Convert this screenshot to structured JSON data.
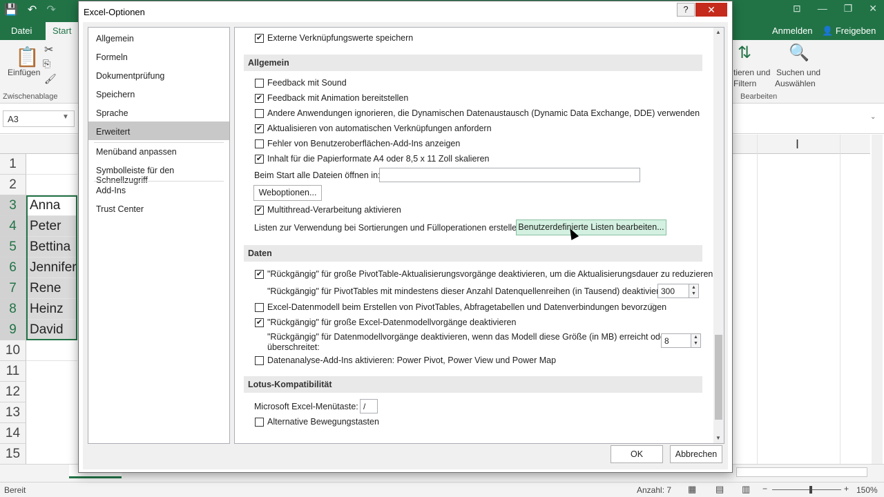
{
  "excel": {
    "tabs": {
      "datei": "Datei",
      "start": "Start"
    },
    "account": {
      "anmelden": "Anmelden",
      "freigeben": "Freigeben"
    },
    "ribbon": {
      "einfuegen": "Einfügen",
      "zwischenablage": "Zwischenablage",
      "sortieren_l1": "tieren und",
      "sortieren_l2": "Filtern",
      "suchen_l1": "Suchen und",
      "suchen_l2": "Auswählen",
      "bearbeiten": "Bearbeiten"
    },
    "namebox": "A3",
    "rows": [
      "1",
      "2",
      "3",
      "4",
      "5",
      "6",
      "7",
      "8",
      "9",
      "10",
      "11",
      "12",
      "13",
      "14",
      "15"
    ],
    "cells": [
      "",
      "",
      "Anna",
      "Peter",
      "Bettina",
      "Jennifer",
      "Rene",
      "Heinz",
      "David",
      "",
      "",
      "",
      "",
      "",
      ""
    ],
    "status": {
      "ready": "Bereit",
      "count": "Anzahl: 7",
      "zoom": "150%"
    }
  },
  "dialog": {
    "title": "Excel-Optionen",
    "help": "?",
    "close": "✕",
    "nav": [
      "Allgemein",
      "Formeln",
      "Dokumentprüfung",
      "Speichern",
      "Sprache",
      "Erweitert",
      "Menüband anpassen",
      "Symbolleiste für den Schnellzugriff",
      "Add-Ins",
      "Trust Center"
    ],
    "options": {
      "externe": "Externe Verknüpfungswerte speichern",
      "allgemein_hdr": "Allgemein",
      "sound": "Feedback mit Sound",
      "animation": "Feedback mit Animation bereitstellen",
      "dde": "Andere Anwendungen ignorieren, die Dynamischen Datenaustausch (Dynamic Data Exchange, DDE) verwenden",
      "aktualisieren": "Aktualisieren von automatischen Verknüpfungen anfordern",
      "fehler": "Fehler von Benutzeroberflächen-Add-Ins anzeigen",
      "inhalt": "Inhalt für die Papierformate A4 oder 8,5 x 11 Zoll skalieren",
      "beim_start": "Beim Start alle Dateien öffnen in:",
      "beim_start_value": "",
      "weboptionen": "Weboptionen...",
      "multithread": "Multithread-Verarbeitung aktivieren",
      "listen": "Listen zur Verwendung bei Sortierungen und Fülloperationen erstellen:",
      "listen_btn": "Benutzerdefinierte Listen bearbeiten...",
      "daten_hdr": "Daten",
      "rueck1": "\"Rückgängig\" für große PivotTable-Aktualisierungsvorgänge deaktivieren, um die Aktualisierungsdauer zu reduzieren",
      "rueck2": "\"Rückgängig\" für PivotTables mit mindestens dieser Anzahl Datenquellenreihen (in Tausend) deaktivieren:",
      "rueck2_value": "300",
      "datenmodell": "Excel-Datenmodell beim Erstellen von PivotTables, Abfragetabellen und Datenverbindungen bevorzugen",
      "rueck3": "\"Rückgängig\" für große Excel-Datenmodellvorgänge deaktivieren",
      "rueck4_l1": "\"Rückgängig\" für Datenmodellvorgänge deaktivieren, wenn das Modell diese Größe (in MB) erreicht oder",
      "rueck4_l2": "überschreitet:",
      "rueck4_value": "8",
      "addins": "Datenanalyse-Add-Ins aktivieren: Power Pivot, Power View und Power Map",
      "lotus_hdr": "Lotus-Kompatibilität",
      "menutaste": "Microsoft Excel-Menütaste:",
      "menutaste_value": "/",
      "bewegung": "Alternative Bewegungstasten"
    },
    "ok": "OK",
    "cancel": "Abbrechen"
  },
  "colors": {
    "excel_green": "#217346",
    "hot_button": "#d3f0e0",
    "close_red": "#c42b1c"
  }
}
